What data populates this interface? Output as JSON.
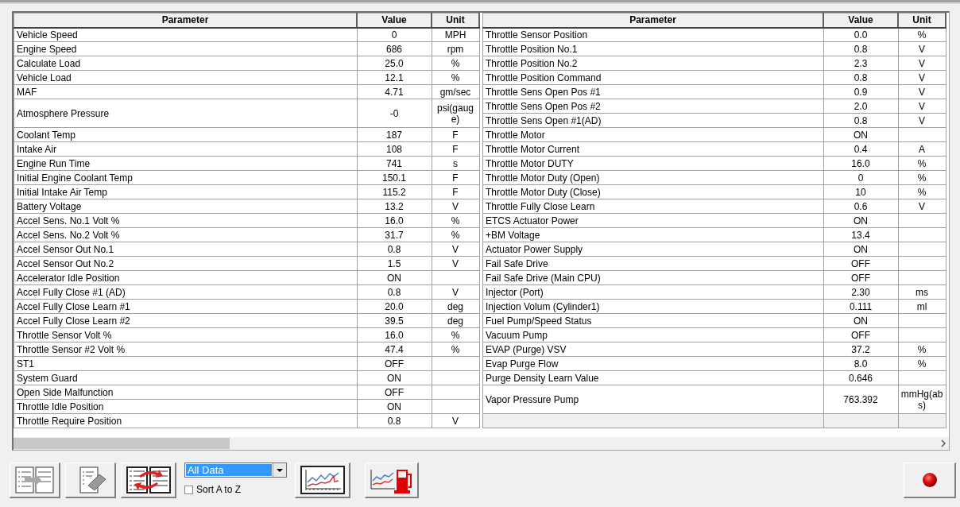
{
  "left_table": {
    "columns": [
      "Parameter",
      "Value",
      "Unit"
    ],
    "rows": [
      {
        "parameter": "Vehicle Speed",
        "value": "0",
        "unit": "MPH"
      },
      {
        "parameter": "Engine Speed",
        "value": "686",
        "unit": "rpm"
      },
      {
        "parameter": "Calculate Load",
        "value": "25.0",
        "unit": "%"
      },
      {
        "parameter": "Vehicle Load",
        "value": "12.1",
        "unit": "%"
      },
      {
        "parameter": "MAF",
        "value": "4.71",
        "unit": "gm/sec"
      },
      {
        "parameter": "Atmosphere Pressure",
        "value": "-0",
        "unit": "psi(gauge)"
      },
      {
        "parameter": "Coolant Temp",
        "value": "187",
        "unit": "F"
      },
      {
        "parameter": "Intake Air",
        "value": "108",
        "unit": "F"
      },
      {
        "parameter": "Engine Run Time",
        "value": "741",
        "unit": "s"
      },
      {
        "parameter": "Initial Engine Coolant Temp",
        "value": "150.1",
        "unit": "F"
      },
      {
        "parameter": "Initial Intake Air Temp",
        "value": "115.2",
        "unit": "F"
      },
      {
        "parameter": "Battery Voltage",
        "value": "13.2",
        "unit": "V"
      },
      {
        "parameter": "Accel Sens. No.1 Volt %",
        "value": "16.0",
        "unit": "%"
      },
      {
        "parameter": "Accel Sens. No.2 Volt %",
        "value": "31.7",
        "unit": "%"
      },
      {
        "parameter": "Accel Sensor Out No.1",
        "value": "0.8",
        "unit": "V"
      },
      {
        "parameter": "Accel Sensor Out No.2",
        "value": "1.5",
        "unit": "V"
      },
      {
        "parameter": "Accelerator Idle Position",
        "value": "ON"
      },
      {
        "parameter": "Accel Fully Close #1 (AD)",
        "value": "0.8",
        "unit": "V"
      },
      {
        "parameter": "Accel Fully Close Learn #1",
        "value": "20.0",
        "unit": "deg"
      },
      {
        "parameter": "Accel Fully Close Learn #2",
        "value": "39.5",
        "unit": "deg"
      },
      {
        "parameter": "Throttle Sensor Volt %",
        "value": "16.0",
        "unit": "%"
      },
      {
        "parameter": "Throttle Sensor #2 Volt %",
        "value": "47.4",
        "unit": "%"
      },
      {
        "parameter": "ST1",
        "value": "OFF"
      },
      {
        "parameter": "System Guard",
        "value": "ON"
      },
      {
        "parameter": "Open Side Malfunction",
        "value": "OFF"
      },
      {
        "parameter": "Throttle Idle Position",
        "value": "ON"
      },
      {
        "parameter": "Throttle Require Position",
        "value": "0.8",
        "unit": "V"
      }
    ]
  },
  "right_table": {
    "columns": [
      "Parameter",
      "Value",
      "Unit"
    ],
    "rows": [
      {
        "parameter": "Throttle Sensor Position",
        "value": "0.0",
        "unit": "%"
      },
      {
        "parameter": "Throttle Position No.1",
        "value": "0.8",
        "unit": "V"
      },
      {
        "parameter": "Throttle Position No.2",
        "value": "2.3",
        "unit": "V"
      },
      {
        "parameter": "Throttle Position Command",
        "value": "0.8",
        "unit": "V"
      },
      {
        "parameter": "Throttle Sens Open Pos #1",
        "value": "0.9",
        "unit": "V"
      },
      {
        "parameter": "Throttle Sens Open Pos #2",
        "value": "2.0",
        "unit": "V"
      },
      {
        "parameter": "Throttle Sens Open #1(AD)",
        "value": "0.8",
        "unit": "V"
      },
      {
        "parameter": "Throttle Motor",
        "value": "ON"
      },
      {
        "parameter": "Throttle Motor Current",
        "value": "0.4",
        "unit": "A"
      },
      {
        "parameter": "Throttle Motor DUTY",
        "value": "16.0",
        "unit": "%"
      },
      {
        "parameter": "Throttle Motor Duty (Open)",
        "value": "0",
        "unit": "%"
      },
      {
        "parameter": "Throttle Motor Duty (Close)",
        "value": "10",
        "unit": "%"
      },
      {
        "parameter": "Throttle Fully Close Learn",
        "value": "0.6",
        "unit": "V"
      },
      {
        "parameter": "ETCS Actuator Power",
        "value": "ON"
      },
      {
        "parameter": "+BM Voltage",
        "value": "13.4"
      },
      {
        "parameter": "Actuator Power Supply",
        "value": "ON"
      },
      {
        "parameter": "Fail Safe Drive",
        "value": "OFF"
      },
      {
        "parameter": "Fail Safe Drive (Main CPU)",
        "value": "OFF"
      },
      {
        "parameter": "Injector (Port)",
        "value": "2.30",
        "unit": "ms"
      },
      {
        "parameter": "Injection Volum (Cylinder1)",
        "value": "0.111",
        "unit": "ml"
      },
      {
        "parameter": "Fuel Pump/Speed Status",
        "value": "ON"
      },
      {
        "parameter": "Vacuum Pump",
        "value": "OFF"
      },
      {
        "parameter": "EVAP (Purge) VSV",
        "value": "37.2",
        "unit": "%"
      },
      {
        "parameter": "Evap Purge Flow",
        "value": "8.0",
        "unit": "%"
      },
      {
        "parameter": "Purge Density Learn Value",
        "value": "0.646"
      },
      {
        "parameter": "Vapor Pressure Pump",
        "value": "763.392",
        "unit": "mmHg(abs)"
      }
    ]
  },
  "toolbar": {
    "dropdown": {
      "value": "All Data"
    },
    "sort_checkbox": {
      "label": "Sort A to Z",
      "checked": false
    }
  }
}
